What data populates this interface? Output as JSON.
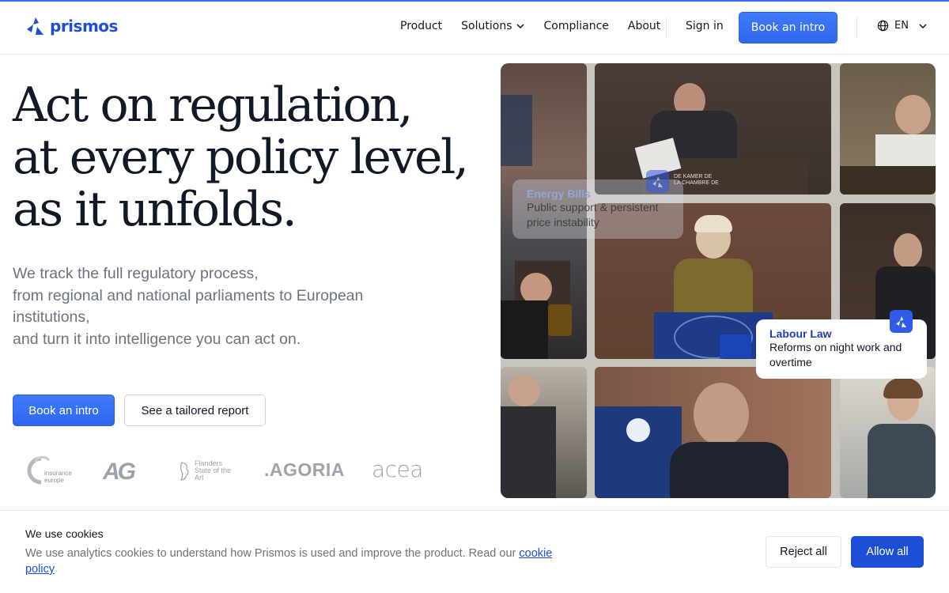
{
  "brand": {
    "name": "prismos",
    "color": "#1d4ed8",
    "accent": "#3b6cf6"
  },
  "nav": {
    "items": [
      {
        "label": "Product"
      },
      {
        "label": "Solutions",
        "has_dropdown": true
      },
      {
        "label": "Compliance"
      },
      {
        "label": "About"
      }
    ],
    "sign_in": "Sign in",
    "cta": "Book an intro",
    "language": "EN"
  },
  "hero": {
    "title_lines": [
      "Act on regulation,",
      "at every policy level,",
      "as it unfolds."
    ],
    "subtitle_lines": [
      "We track the full regulatory process,",
      "from regional and national parliaments to European",
      "institutions,",
      "and turn it into intelligence you can act on."
    ],
    "primary_button": "Book an intro",
    "secondary_button": "See a tailored report"
  },
  "clients": [
    {
      "name": "insurance europe",
      "icon": "insurance-europe-logo"
    },
    {
      "name": "AG",
      "icon": "ag-logo"
    },
    {
      "name": "Flanders State of the Art",
      "icon": "flanders-logo"
    },
    {
      "name": ".AGORIA",
      "icon": "agoria-logo"
    },
    {
      "name": "acea",
      "icon": "acea-logo"
    }
  ],
  "cards": [
    {
      "title": "Energy Bills",
      "text": "Public support & persistent price instability"
    },
    {
      "title": "Labour Law",
      "text": "Reforms on night work and overtime"
    }
  ],
  "grid_captions": {
    "chamber_sign": "DE KAMER DE\nLA CHAMBRE DE"
  },
  "cookie": {
    "title": "We use cookies",
    "text": "We use analytics cookies to understand how Prismos is used and improve the product. Read our ",
    "link": "cookie policy",
    "reject": "Reject all",
    "allow": "Allow all"
  }
}
